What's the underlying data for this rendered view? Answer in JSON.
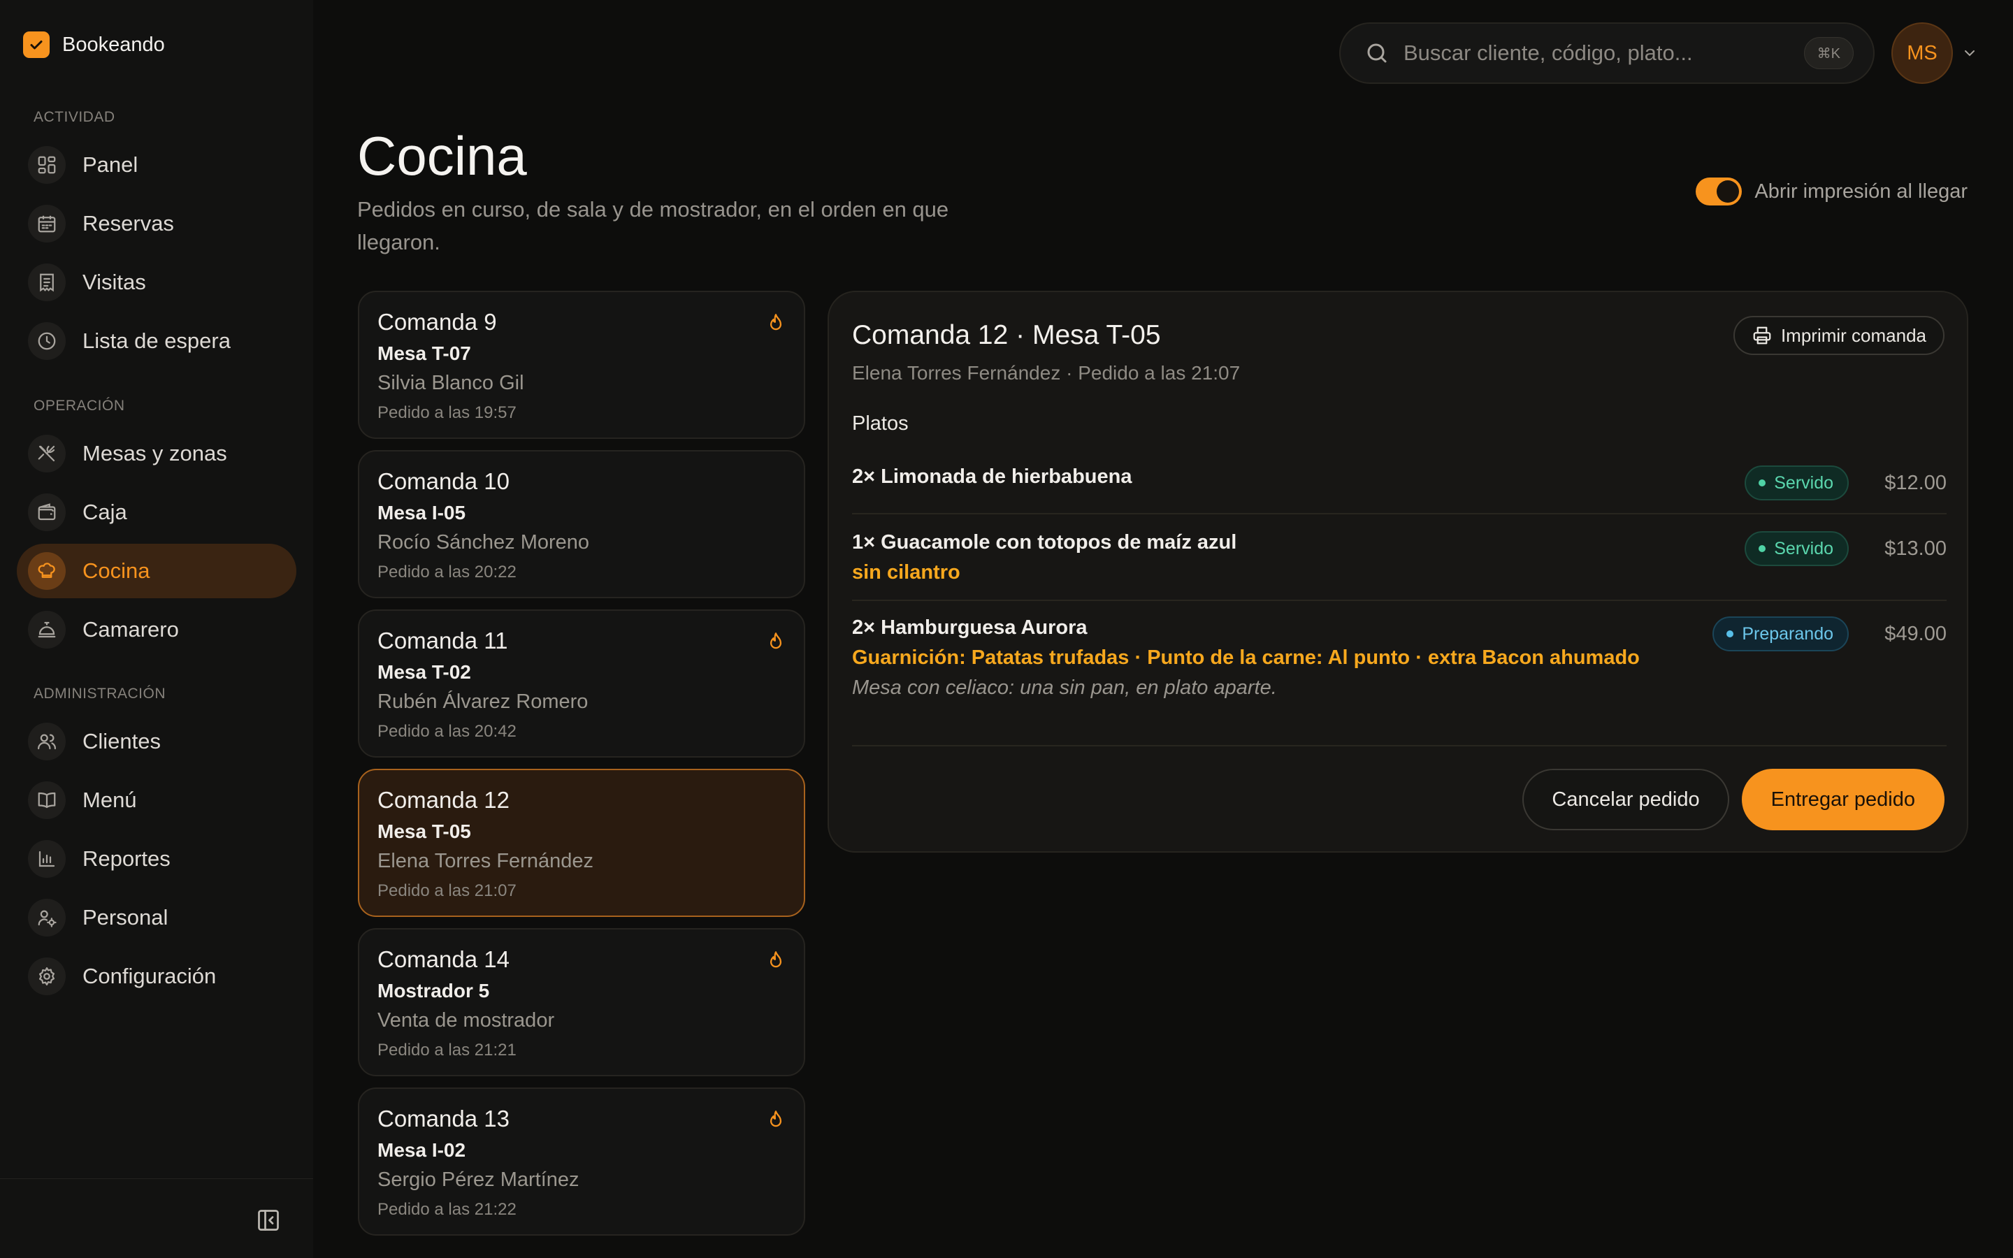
{
  "app": {
    "name": "Bookeando"
  },
  "sidebar": {
    "sections": [
      {
        "label": "Actividad"
      },
      {
        "label": "Operación"
      },
      {
        "label": "Administración"
      }
    ],
    "items": [
      {
        "label": "Panel",
        "icon": "dashboard-icon"
      },
      {
        "label": "Reservas",
        "icon": "calendar-icon"
      },
      {
        "label": "Visitas",
        "icon": "receipt-icon"
      },
      {
        "label": "Lista de espera",
        "icon": "clock-icon"
      },
      {
        "label": "Mesas y zonas",
        "icon": "utensils-icon"
      },
      {
        "label": "Caja",
        "icon": "wallet-icon"
      },
      {
        "label": "Cocina",
        "icon": "chef-hat-icon",
        "active": true
      },
      {
        "label": "Camarero",
        "icon": "service-bell-icon"
      },
      {
        "label": "Clientes",
        "icon": "users-icon"
      },
      {
        "label": "Menú",
        "icon": "book-icon"
      },
      {
        "label": "Reportes",
        "icon": "bar-chart-icon"
      },
      {
        "label": "Personal",
        "icon": "user-cog-icon"
      },
      {
        "label": "Configuración",
        "icon": "gear-icon"
      }
    ]
  },
  "topbar": {
    "search_placeholder": "Buscar cliente, código, plato...",
    "search_shortcut": "⌘K",
    "avatar_initials": "MS"
  },
  "page": {
    "title": "Cocina",
    "subtitle": "Pedidos en curso, de sala y de mostrador, en el orden en que llegaron.",
    "toggle_label": "Abrir impresión al llegar",
    "toggle_on": true
  },
  "orders": [
    {
      "title": "Comanda 9",
      "table": "Mesa T-07",
      "client": "Silvia Blanco Gil",
      "time": "Pedido a las 19:57",
      "flame": true
    },
    {
      "title": "Comanda 10",
      "table": "Mesa I-05",
      "client": "Rocío Sánchez Moreno",
      "time": "Pedido a las 20:22",
      "flame": false
    },
    {
      "title": "Comanda 11",
      "table": "Mesa T-02",
      "client": "Rubén Álvarez Romero",
      "time": "Pedido a las 20:42",
      "flame": true
    },
    {
      "title": "Comanda 12",
      "table": "Mesa T-05",
      "client": "Elena Torres Fernández",
      "time": "Pedido a las 21:07",
      "flame": false,
      "selected": true
    },
    {
      "title": "Comanda 14",
      "table": "Mostrador 5",
      "client": "Venta de mostrador",
      "time": "Pedido a las 21:21",
      "flame": true
    },
    {
      "title": "Comanda 13",
      "table": "Mesa I-02",
      "client": "Sergio Pérez Martínez",
      "time": "Pedido a las 21:22",
      "flame": true
    }
  ],
  "detail": {
    "title": "Comanda 12 · Mesa T-05",
    "subtitle": "Elena Torres Fernández · Pedido a las 21:07",
    "print_label": "Imprimir comanda",
    "section_label": "Platos",
    "items": [
      {
        "name": "2× Limonada de hierbabuena",
        "mods": "",
        "note": "",
        "status": "Servido",
        "price": "$12.00"
      },
      {
        "name": "1× Guacamole con totopos de maíz azul",
        "mods": "sin cilantro",
        "note": "",
        "status": "Servido",
        "price": "$13.00"
      },
      {
        "name": "2× Hamburguesa Aurora",
        "mods": "Guarnición: Patatas trufadas · Punto de la carne: Al punto · extra Bacon ahumado",
        "note": "Mesa con celiaco: una sin pan, en plato aparte.",
        "status": "Preparando",
        "price": "$49.00"
      }
    ],
    "cancel_label": "Cancelar pedido",
    "deliver_label": "Entregar pedido"
  },
  "colors": {
    "accent": "#f7931e",
    "served": "#4fd3a6",
    "preparing": "#58bfe8",
    "mods": "#f7a81e"
  }
}
